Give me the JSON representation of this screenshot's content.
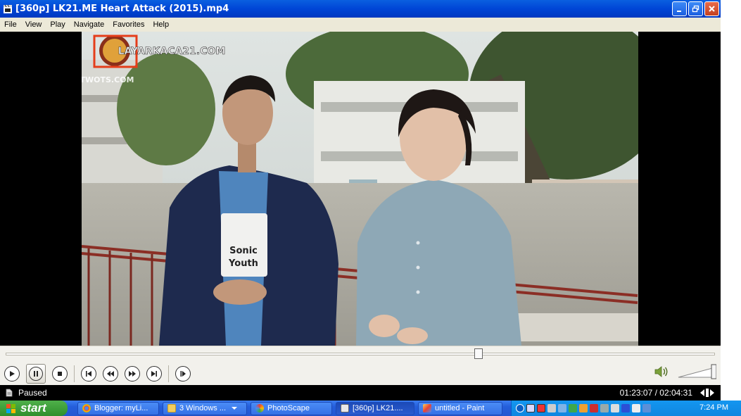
{
  "window": {
    "title": "[360p] LK21.ME Heart Attack (2015).mp4",
    "buttons": {
      "minimize": "minimize-icon",
      "restore": "restore-icon",
      "close": "close-icon"
    }
  },
  "menu": {
    "items": [
      "File",
      "View",
      "Play",
      "Navigate",
      "Favorites",
      "Help"
    ]
  },
  "video": {
    "watermark_main": "LAYARKACA21.COM",
    "watermark_sub": "TWOTS.COM",
    "shirt_text_1": "Sonic",
    "shirt_text_2": "Youth"
  },
  "playback": {
    "progress": 0.667,
    "volume": 1.0,
    "status": "Paused",
    "time": "01:23:07 / 02:04:31"
  },
  "controls": {
    "icons": [
      "play-icon",
      "pause-icon",
      "stop-icon",
      "skip-back-icon",
      "rewind-icon",
      "fast-forward-icon",
      "skip-forward-icon",
      "frame-step-icon",
      "volume-icon"
    ]
  },
  "taskbar": {
    "start_label": "start",
    "tasks": [
      {
        "label": "Blogger: myLi...",
        "icon": "chrome-icon"
      },
      {
        "label": "3 Windows ...",
        "icon": "folder-icon"
      },
      {
        "label": "PhotoScape",
        "icon": "photoscape-icon"
      },
      {
        "label": "[360p] LK21....",
        "icon": "mpc-icon"
      },
      {
        "label": "untitled - Paint",
        "icon": "paint-icon"
      }
    ],
    "clock": "7:24 PM"
  },
  "colors": {
    "titlebar": "#0045d6",
    "menubar": "#ece9d8",
    "video_bg": "#000000",
    "taskbar": "#245edb",
    "start": "#2f8f2b",
    "tray": "#0f86e0"
  }
}
